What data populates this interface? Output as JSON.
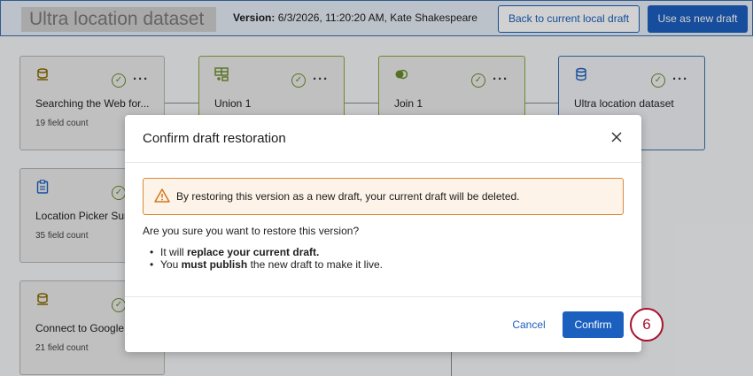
{
  "header": {
    "title": "Ultra location dataset",
    "version_label": "Version:",
    "version_value": "6/3/2026, 11:20:20 AM, Kate Shakespeare",
    "back_button": "Back to current local draft",
    "use_button": "Use as new draft"
  },
  "nodes": [
    {
      "name": "Searching the Web for...",
      "count": "19 field count",
      "icon": "database-stack-icon"
    },
    {
      "name": "Union 1",
      "icon": "union-icon"
    },
    {
      "name": "Join 1",
      "icon": "join-icon"
    },
    {
      "name": "Ultra location dataset",
      "icon": "database-icon"
    },
    {
      "name": "Location Picker Surv",
      "count": "35 field count",
      "icon": "clipboard-icon"
    },
    {
      "name": "Connect to Google I",
      "count": "21 field count",
      "icon": "database-stack-icon"
    }
  ],
  "modal": {
    "title": "Confirm draft restoration",
    "warning": "By restoring this version as a new draft, your current draft will be deleted.",
    "question": "Are you sure you want to restore this version?",
    "bullet1_prefix": "It will ",
    "bullet1_bold": "replace your current draft.",
    "bullet2_prefix": "You ",
    "bullet2_bold": "must publish",
    "bullet2_suffix": " the new draft to make it live.",
    "cancel": "Cancel",
    "confirm": "Confirm"
  },
  "step_badge": "6",
  "colors": {
    "accent": "#1b5fbf",
    "warning_border": "#d98a3a",
    "badge": "#a8122b"
  }
}
